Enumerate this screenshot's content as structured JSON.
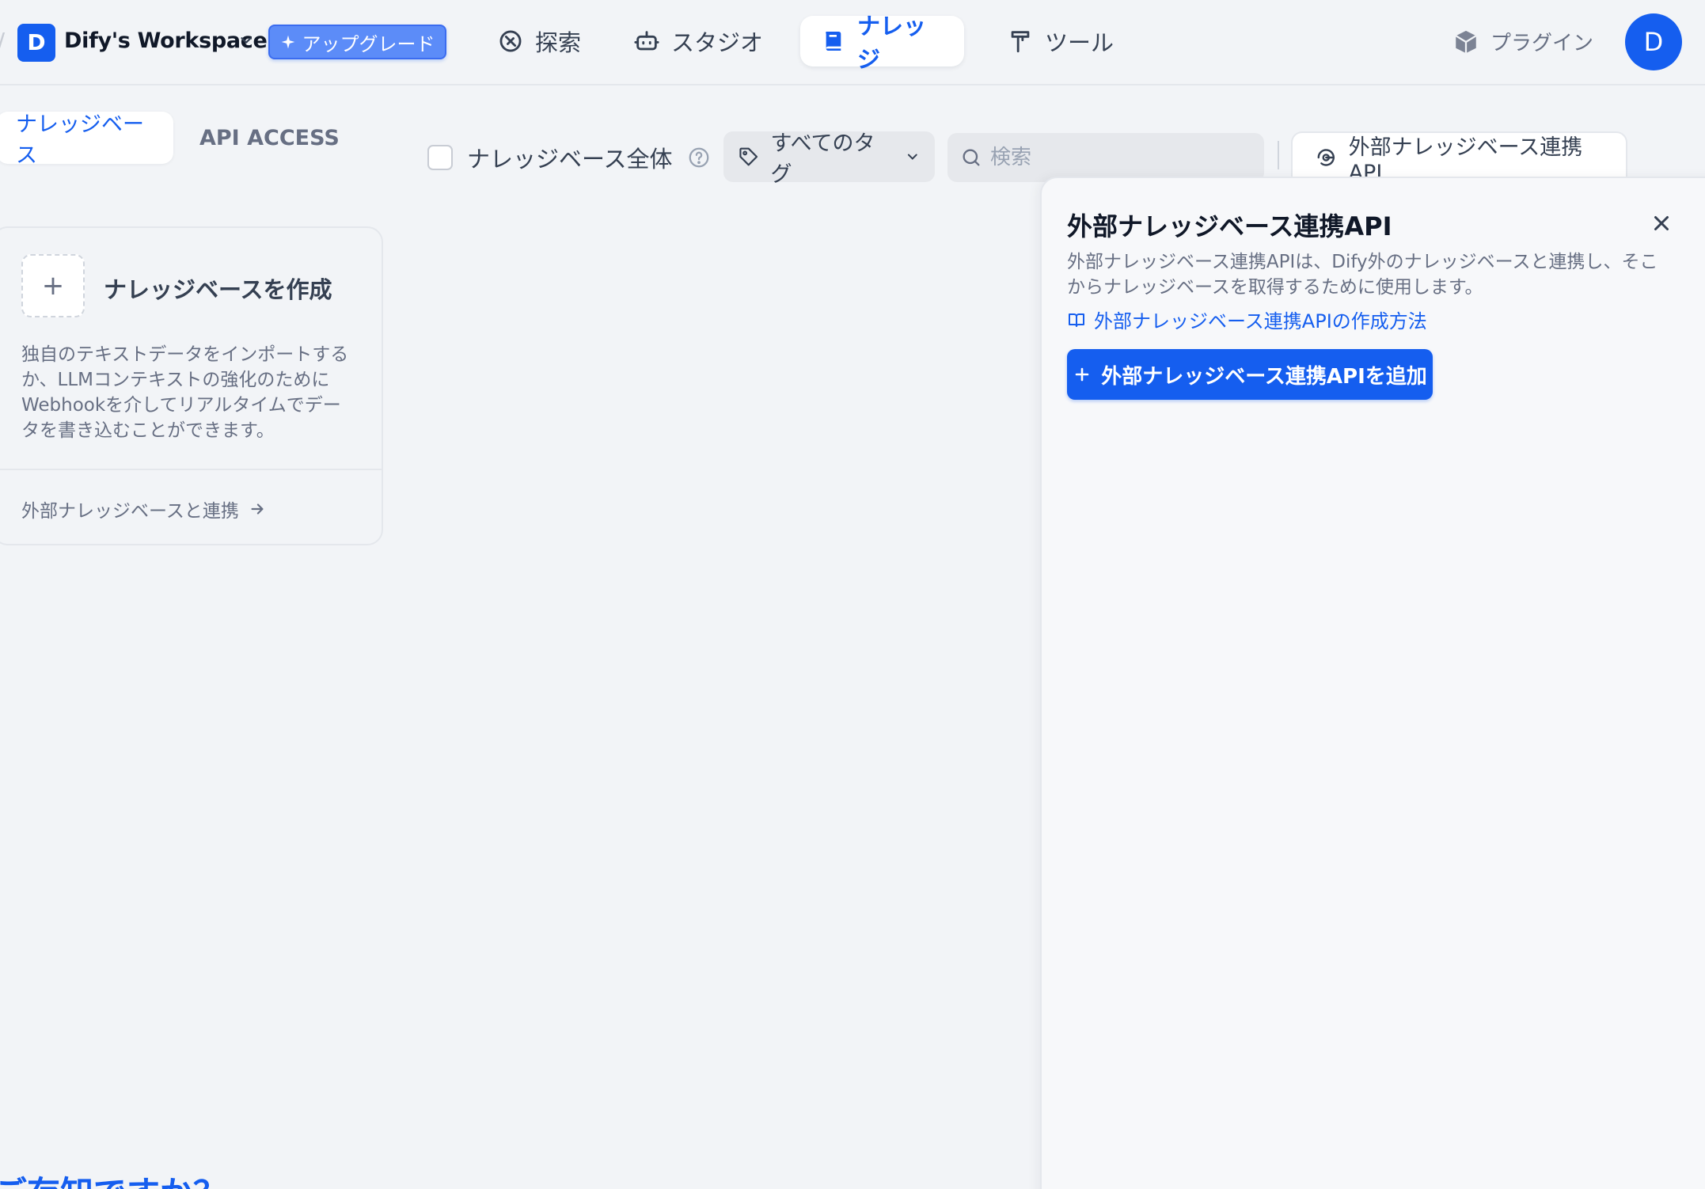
{
  "workspace": {
    "initial": "D",
    "name": "Dify's Workspace",
    "upgrade_label": "アップグレード"
  },
  "nav": {
    "explore": "探索",
    "studio": "スタジオ",
    "knowledge": "ナレッジ",
    "tools": "ツール",
    "plugins": "プラグイン",
    "user_initial": "D"
  },
  "subtabs": {
    "knowledge_base": "ナレッジベース",
    "api_access": "API ACCESS"
  },
  "filters": {
    "scope_label": "ナレッジベース全体",
    "tags_label": "すべてのタグ",
    "search_placeholder": "検索",
    "external_api_button": "外部ナレッジベース連携API"
  },
  "create_card": {
    "title": "ナレッジベースを作成",
    "description": "独自のテキストデータをインポートするか、LLMコンテキストの強化のためにWebhookを介してリアルタイムでデータを書き込むことができます。",
    "connect_link": "外部ナレッジベースと連携"
  },
  "footer_heading": "ご存知ですか？",
  "panel": {
    "title": "外部ナレッジベース連携API",
    "description": "外部ナレッジベース連携APIは、Dify外のナレッジベースと連携し、そこからナレッジベースを取得するために使用します。",
    "howto_link": "外部ナレッジベース連携APIの作成方法",
    "add_button": "外部ナレッジベース連携APIを追加"
  },
  "colors": {
    "accent": "#155eef",
    "background": "#f2f4f7",
    "text": "#354052",
    "muted": "#676f83"
  },
  "icons": [
    "chevron-down-icon",
    "sparkle-icon",
    "compass-icon",
    "robot-icon",
    "book-icon",
    "hammer-icon",
    "cube-icon",
    "help-icon",
    "tag-icon",
    "search-icon",
    "api-icon",
    "plus-icon",
    "arrow-right-icon",
    "close-icon",
    "book-open-icon"
  ]
}
